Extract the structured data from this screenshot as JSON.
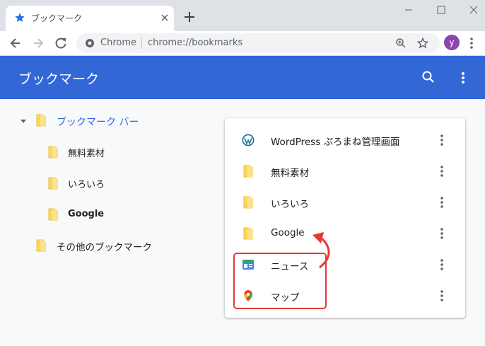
{
  "tab": {
    "title": "ブックマーク"
  },
  "omnibox": {
    "site_label": "Chrome",
    "url": "chrome://bookmarks"
  },
  "profile": {
    "initial": "y"
  },
  "header": {
    "title": "ブックマーク"
  },
  "sidebar": {
    "items": [
      {
        "label": "ブックマーク バー",
        "selected": true
      },
      {
        "label": "無料素材"
      },
      {
        "label": "いろいろ"
      },
      {
        "label": "Google",
        "bold": true
      },
      {
        "label": "その他のブックマーク"
      }
    ]
  },
  "list": {
    "items": [
      {
        "label": "WordPress ぷろまね管理画面",
        "icon": "wordpress-icon"
      },
      {
        "label": "無料素材",
        "icon": "folder-icon"
      },
      {
        "label": "いろいろ",
        "icon": "folder-icon"
      },
      {
        "label": "Google",
        "icon": "folder-icon"
      },
      {
        "label": "ニュース",
        "icon": "google-news-icon"
      },
      {
        "label": "マップ",
        "icon": "google-maps-icon"
      }
    ]
  },
  "colors": {
    "header": "#3367d6",
    "accent": "#1a73e8",
    "annotation": "#e53935",
    "folder": "#fdd663"
  }
}
